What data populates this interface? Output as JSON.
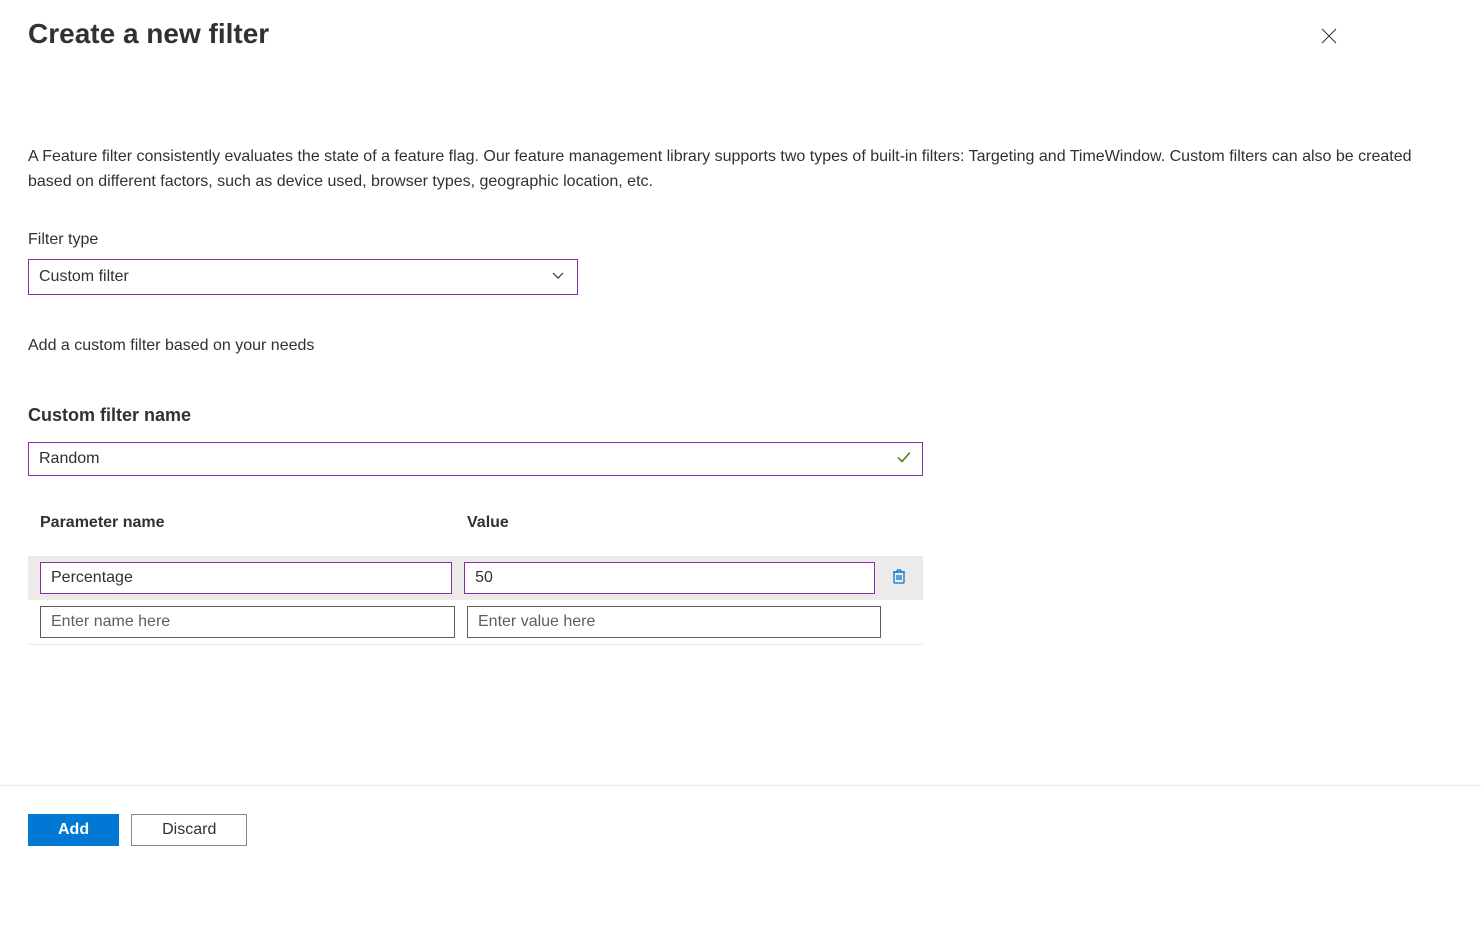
{
  "header": {
    "title": "Create a new filter"
  },
  "description": "A Feature filter consistently evaluates the state of a feature flag. Our feature management library supports two types of built-in filters: Targeting and TimeWindow. Custom filters can also be created based on different factors, such as device used, browser types, geographic location, etc.",
  "filterType": {
    "label": "Filter type",
    "selected": "Custom filter"
  },
  "subtext": "Add a custom filter based on your needs",
  "customFilterName": {
    "label": "Custom filter name",
    "value": "Random"
  },
  "parameters": {
    "nameHeader": "Parameter name",
    "valueHeader": "Value",
    "rows": [
      {
        "name": "Percentage",
        "value": "50"
      }
    ],
    "namePlaceholder": "Enter name here",
    "valuePlaceholder": "Enter value here"
  },
  "footer": {
    "add": "Add",
    "discard": "Discard"
  }
}
